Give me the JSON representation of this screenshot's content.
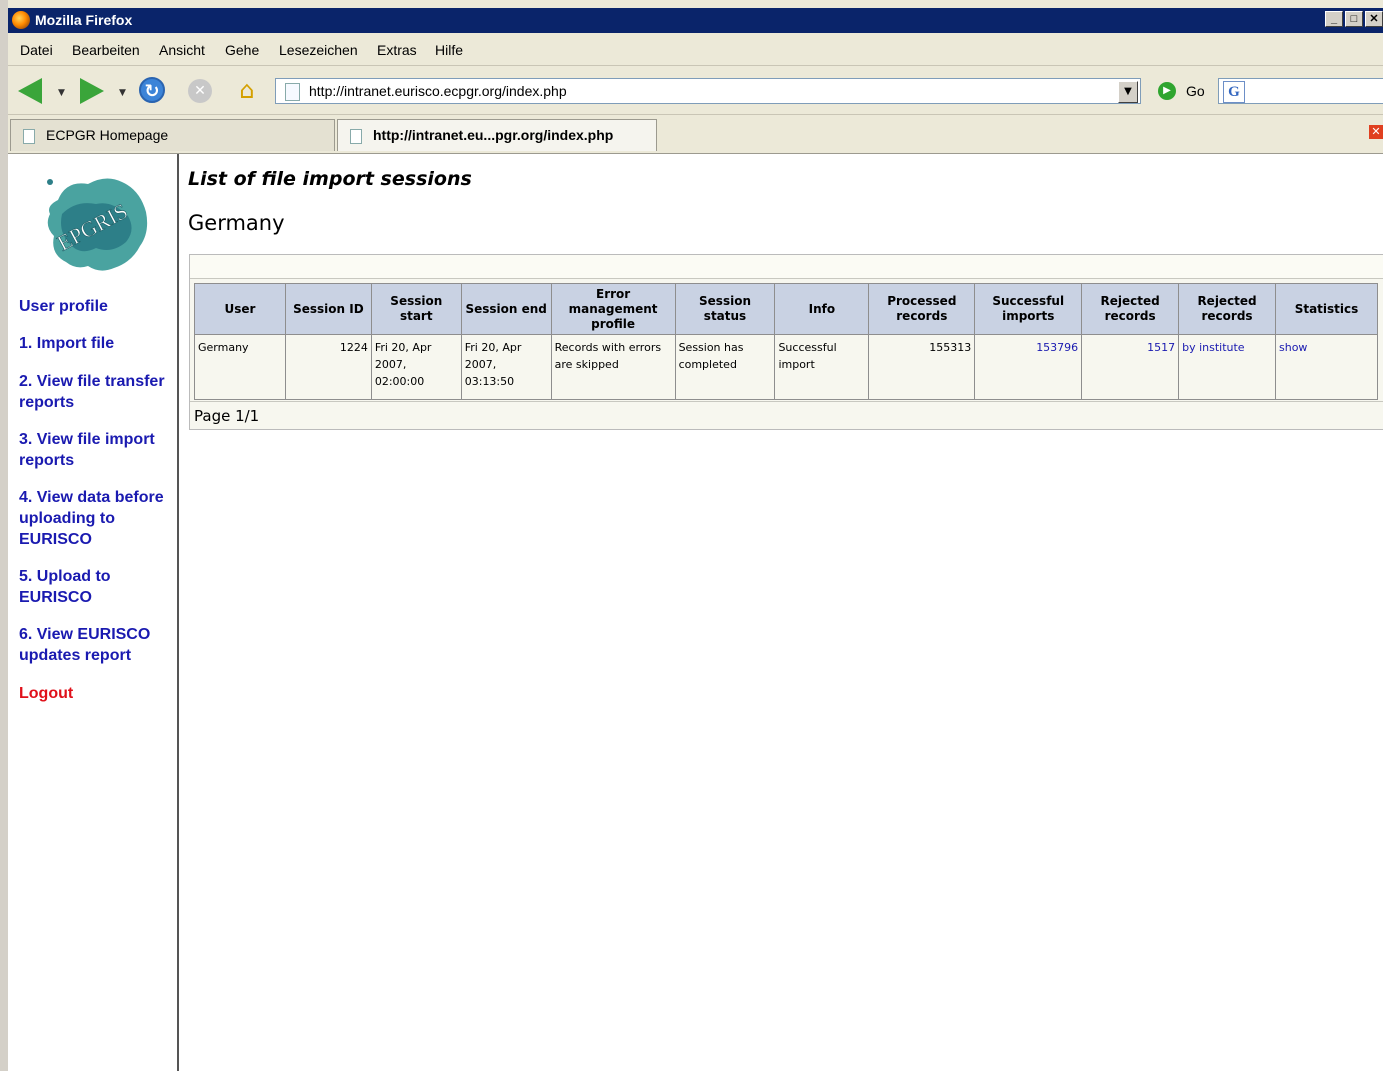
{
  "window": {
    "title": "Mozilla Firefox"
  },
  "menu": [
    "Datei",
    "Bearbeiten",
    "Ansicht",
    "Gehe",
    "Lesezeichen",
    "Extras",
    "Hilfe"
  ],
  "navbar": {
    "url": "http://intranet.eurisco.ecpgr.org/index.php",
    "go_label": "Go"
  },
  "tabs": [
    {
      "label": "ECPGR Homepage",
      "active": false
    },
    {
      "label": "http://intranet.eu...pgr.org/index.php",
      "active": true
    }
  ],
  "sidebar": {
    "logo_text": "EPGRIS",
    "items": [
      {
        "label": "User profile"
      },
      {
        "label": "1. Import file"
      },
      {
        "label": "2. View file transfer reports"
      },
      {
        "label": "3. View file import reports"
      },
      {
        "label": "4. View data before uploading to EURISCO"
      },
      {
        "label": "5. Upload to EURISCO"
      },
      {
        "label": "6. View EURISCO updates report"
      },
      {
        "label": "Logout"
      }
    ]
  },
  "main": {
    "title": "List of file import sessions",
    "country": "Germany",
    "columns": [
      "User",
      "Session ID",
      "Session start",
      "Session end",
      "Error management profile",
      "Session status",
      "Info",
      "Processed records",
      "Successful imports",
      "Rejected records",
      "Rejected records",
      "Statistics"
    ],
    "rows": [
      {
        "user": "Germany",
        "session_id": "1224",
        "start": "Fri 20, Apr 2007, 02:00:00",
        "end": "Fri 20, Apr 2007, 03:13:50",
        "error_profile": "Records with errors are skipped",
        "status": "Session has completed",
        "info": "Successful import",
        "processed": "155313",
        "successful": "153796",
        "rejected": "1517",
        "rejected_by": "by institute",
        "statistics": "show"
      }
    ],
    "pager": "Page 1/1"
  },
  "colors": {
    "titlebar": "#0a246a",
    "link": "#1a1ab0",
    "logout": "#e0101a",
    "table_header": "#c9d2e3"
  }
}
